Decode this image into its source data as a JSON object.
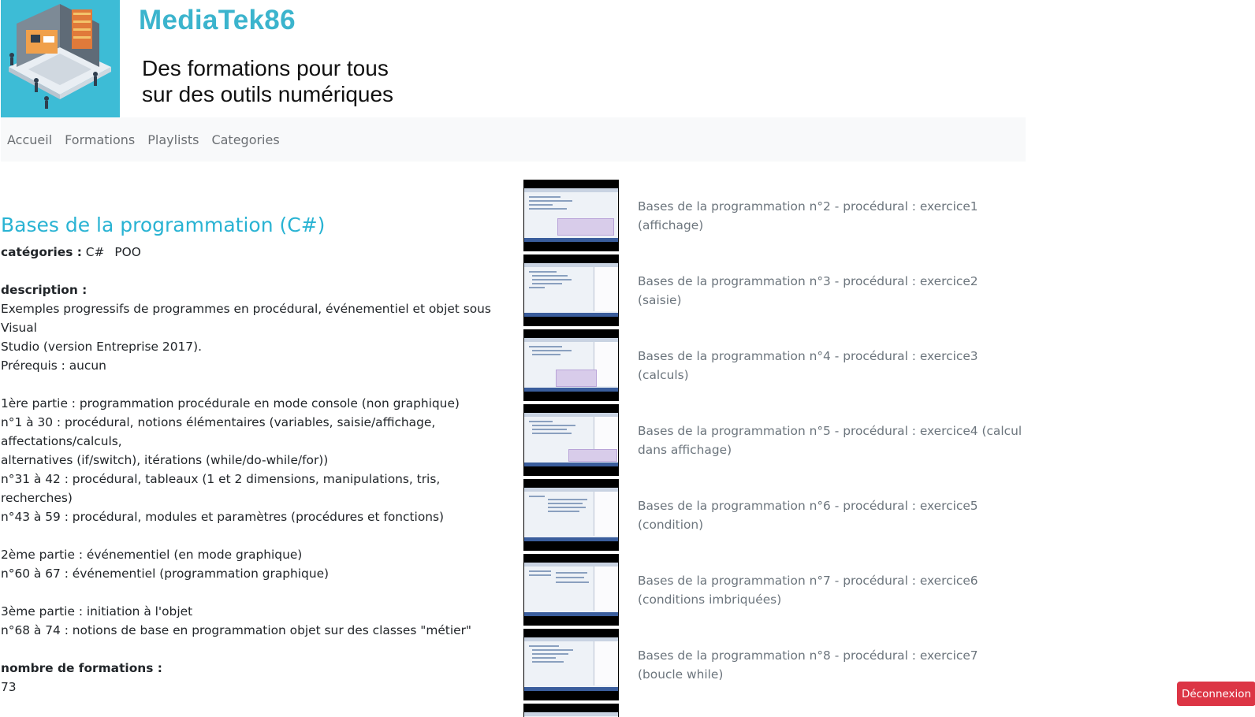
{
  "header": {
    "site_title": "MediaTek86",
    "tagline_line1": "Des formations pour tous",
    "tagline_line2": "sur des outils numériques"
  },
  "nav": {
    "items": [
      {
        "label": "Accueil"
      },
      {
        "label": "Formations"
      },
      {
        "label": "Playlists"
      },
      {
        "label": "Categories"
      }
    ]
  },
  "playlist": {
    "title": "Bases de la programmation (C#)",
    "categories_label": "catégories :",
    "categories": [
      "C#",
      "POO"
    ],
    "description_label": "description :",
    "description_lines": [
      "Exemples progressifs de programmes en procédural, événementiel et objet sous Visual",
      "Studio (version Entreprise 2017).",
      "Prérequis : aucun",
      "",
      "1ère partie : programmation procédurale en mode console (non graphique)",
      "n°1 à 30 : procédural, notions élémentaires (variables, saisie/affichage, affectations/calculs,",
      "alternatives (if/switch), itérations (while/do-while/for))",
      "n°31 à 42 : procédural, tableaux (1 et 2 dimensions, manipulations, tris, recherches)",
      "n°43 à 59 : procédural, modules et paramètres (procédures et fonctions)",
      "",
      "2ème partie : événementiel (en mode graphique)",
      "n°60 à 67 : événementiel (programmation graphique)",
      "",
      "3ème partie : initiation à l'objet",
      "n°68 à 74 : notions de base en programmation objet sur des classes \"métier\""
    ],
    "count_label": "nombre de formations :",
    "count_value": "73"
  },
  "formations": [
    {
      "title": "Bases de la programmation n°2 - procédural : exercice1 (affichage)"
    },
    {
      "title": "Bases de la programmation n°3 - procédural : exercice2 (saisie)"
    },
    {
      "title": "Bases de la programmation n°4 - procédural : exercice3 (calculs)"
    },
    {
      "title": "Bases de la programmation n°5 - procédural : exercice4 (calcul dans affichage)"
    },
    {
      "title": "Bases de la programmation n°6 - procédural : exercice5 (condition)"
    },
    {
      "title": "Bases de la programmation n°7 - procédural : exercice6 (conditions imbriquées)"
    },
    {
      "title": "Bases de la programmation n°8 - procédural : exercice7 (boucle while)"
    }
  ],
  "logout_label": "Déconnexion",
  "colors": {
    "brand": "#3bb4cd",
    "playlist_title": "#29b3d3",
    "logout": "#dc3545",
    "navbar_bg": "#f8f9fa"
  }
}
